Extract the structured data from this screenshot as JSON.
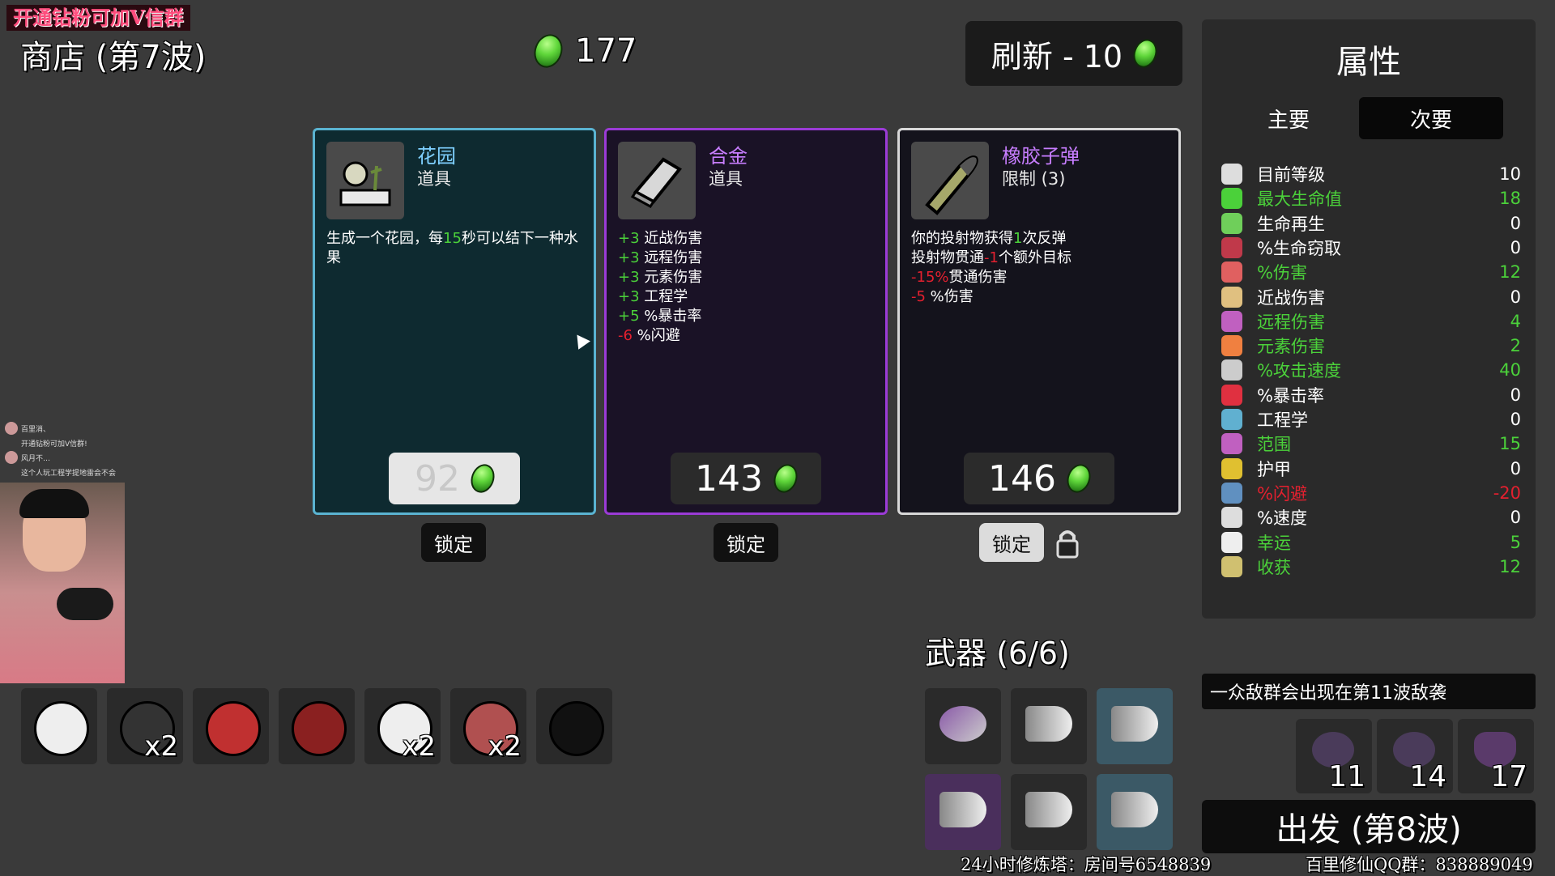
{
  "promo": "开通钻粉可加V信群",
  "header": {
    "title": "商店 (第7波)",
    "gold": "177",
    "reroll_label": "刷新 - 10"
  },
  "shop": [
    {
      "name": "花园",
      "name_color": "#7fd0ff",
      "type": "道具",
      "icon": "garden-icon",
      "desc": [
        [
          {
            "t": "生成一个花园，每",
            "c": "w"
          },
          {
            "t": "15",
            "c": "g"
          },
          {
            "t": "秒可以结下一种水果",
            "c": "w"
          }
        ]
      ],
      "price": "92",
      "lock_label": "锁定"
    },
    {
      "name": "合金",
      "name_color": "#c77dff",
      "type": "道具",
      "icon": "alloy-icon",
      "desc": [
        [
          {
            "t": "+3",
            "c": "g"
          },
          {
            "t": " 近战伤害",
            "c": "w"
          }
        ],
        [
          {
            "t": "+3",
            "c": "g"
          },
          {
            "t": " 远程伤害",
            "c": "w"
          }
        ],
        [
          {
            "t": "+3",
            "c": "g"
          },
          {
            "t": " 元素伤害",
            "c": "w"
          }
        ],
        [
          {
            "t": "+3",
            "c": "g"
          },
          {
            "t": " 工程学",
            "c": "w"
          }
        ],
        [
          {
            "t": "+5",
            "c": "g"
          },
          {
            "t": " %暴击率",
            "c": "w"
          }
        ],
        [
          {
            "t": "-6",
            "c": "r"
          },
          {
            "t": " %闪避",
            "c": "w"
          }
        ]
      ],
      "price": "143",
      "lock_label": "锁定"
    },
    {
      "name": "橡胶子弹",
      "name_color": "#c77dff",
      "type": "限制 (3)",
      "icon": "bullet-icon",
      "desc": [
        [
          {
            "t": "你的投射物获得",
            "c": "w"
          },
          {
            "t": "1",
            "c": "g"
          },
          {
            "t": "次反弹",
            "c": "w"
          }
        ],
        [
          {
            "t": "投射物贯通",
            "c": "w"
          },
          {
            "t": "-1",
            "c": "r"
          },
          {
            "t": "个额外目标",
            "c": "w"
          }
        ],
        [
          {
            "t": "-15%",
            "c": "r"
          },
          {
            "t": "贯通伤害",
            "c": "w"
          }
        ],
        [
          {
            "t": "-5",
            "c": "r"
          },
          {
            "t": " %伤害",
            "c": "w"
          }
        ]
      ],
      "price": "146",
      "lock_label": "锁定"
    }
  ],
  "stats": {
    "title": "属性",
    "tab_primary": "主要",
    "tab_secondary": "次要",
    "rows": [
      {
        "label": "目前等级",
        "value": "10",
        "color": "#ffffff",
        "icon": "level-icon",
        "ic": "#ddd"
      },
      {
        "label": "最大生命值",
        "value": "18",
        "color": "#4bd13a",
        "icon": "heart-icon",
        "ic": "#4bd13a"
      },
      {
        "label": "生命再生",
        "value": "0",
        "color": "#ffffff",
        "icon": "regen-icon",
        "ic": "#6fcf5a"
      },
      {
        "label": "%生命窃取",
        "value": "0",
        "color": "#ffffff",
        "icon": "lifesteal-icon",
        "ic": "#c0394a"
      },
      {
        "label": "%伤害",
        "value": "12",
        "color": "#4bd13a",
        "icon": "damage-icon",
        "ic": "#e06060"
      },
      {
        "label": "近战伤害",
        "value": "0",
        "color": "#ffffff",
        "icon": "sword-icon",
        "ic": "#e0c080"
      },
      {
        "label": "远程伤害",
        "value": "4",
        "color": "#4bd13a",
        "icon": "bow-icon",
        "ic": "#c060c0"
      },
      {
        "label": "元素伤害",
        "value": "2",
        "color": "#4bd13a",
        "icon": "fire-icon",
        "ic": "#f08040"
      },
      {
        "label": "%攻击速度",
        "value": "40",
        "color": "#4bd13a",
        "icon": "hourglass-icon",
        "ic": "#ccc"
      },
      {
        "label": "%暴击率",
        "value": "0",
        "color": "#ffffff",
        "icon": "crit-icon",
        "ic": "#e03040"
      },
      {
        "label": "工程学",
        "value": "0",
        "color": "#ffffff",
        "icon": "wrench-icon",
        "ic": "#60b0d0"
      },
      {
        "label": "范围",
        "value": "15",
        "color": "#4bd13a",
        "icon": "range-icon",
        "ic": "#c060c0"
      },
      {
        "label": "护甲",
        "value": "0",
        "color": "#ffffff",
        "icon": "shield-icon",
        "ic": "#e0c030"
      },
      {
        "label": "%闪避",
        "value": "-20",
        "color": "#e3202f",
        "icon": "dodge-icon",
        "ic": "#6090c0"
      },
      {
        "label": "%速度",
        "value": "0",
        "color": "#ffffff",
        "icon": "boot-icon",
        "ic": "#ddd"
      },
      {
        "label": "幸运",
        "value": "5",
        "color": "#4bd13a",
        "icon": "dice-icon",
        "ic": "#eee"
      },
      {
        "label": "收获",
        "value": "12",
        "color": "#4bd13a",
        "icon": "harvest-icon",
        "ic": "#d0c070"
      }
    ]
  },
  "chat": [
    {
      "user": "百里消、",
      "text": "开通钻粉可加V信群!"
    },
    {
      "user": "风月不…",
      "text": "这个人玩工程学提地雷会不会"
    }
  ],
  "items": [
    {
      "icon": "pirate-head-icon",
      "count": "",
      "color": "#eee"
    },
    {
      "icon": "cannonballs-icon",
      "count": "x2",
      "color": "#333"
    },
    {
      "icon": "dynamite-icon",
      "count": "",
      "color": "#c03030"
    },
    {
      "icon": "flannel-shirt-icon",
      "count": "",
      "color": "#8a2020"
    },
    {
      "icon": "ghost-icon",
      "count": "x2",
      "color": "#eee"
    },
    {
      "icon": "tentacle-icon",
      "count": "x2",
      "color": "#b05050"
    },
    {
      "icon": "eyepatch-icon",
      "count": "",
      "color": "#111"
    }
  ],
  "weapons": {
    "title": "武器 (6/6)",
    "slots": [
      {
        "icon": "rocket-launcher-icon",
        "tier_bg": "#2a2a2a"
      },
      {
        "icon": "megaphone-icon",
        "tier_bg": "#2a2a2a"
      },
      {
        "icon": "megaphone-icon",
        "tier_bg": "#3b5966"
      },
      {
        "icon": "megaphone-icon",
        "tier_bg": "#4a2f5c"
      },
      {
        "icon": "megaphone-icon",
        "tier_bg": "#2a2a2a"
      },
      {
        "icon": "megaphone-icon",
        "tier_bg": "#3b5966"
      }
    ]
  },
  "danger": {
    "text": "一众敌群会出现在第11波敌袭",
    "enemies": [
      {
        "icon": "enemy-horde-icon",
        "wave": "11"
      },
      {
        "icon": "enemy-horde-icon",
        "wave": "14"
      },
      {
        "icon": "enemy-boss-icon",
        "wave": "17"
      }
    ]
  },
  "go_label": "出发 (第8波)",
  "footer": {
    "left": "24小时修炼塔：房间号6548839",
    "right": "百里修仙QQ群：838889049"
  }
}
